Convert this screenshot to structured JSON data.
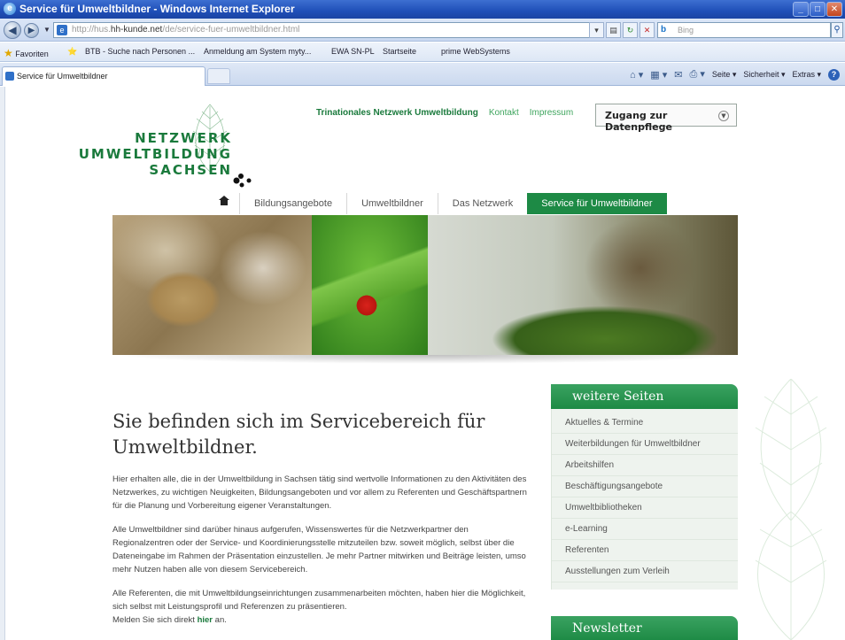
{
  "browser": {
    "window_title": "Service für Umweltbildner - Windows Internet Explorer",
    "url_prefix": "http://hus.",
    "url_domain": "hh-kunde.net",
    "url_path": "/de/service-fuer-umweltbildner.html",
    "search_placeholder": "Bing",
    "favorites": {
      "label": "Favoriten",
      "items": [
        "BTB - Suche nach Personen ...",
        "Anmeldung am System myty...",
        "EWA SN-PL",
        "Startseite",
        "prime WebSystems"
      ]
    },
    "tab_label": "Service für Umweltbildner",
    "commands": [
      "Seite ▾",
      "Sicherheit ▾",
      "Extras ▾"
    ]
  },
  "header": {
    "logo_lines": [
      "NETZWERK",
      "UMWELTBILDUNG",
      "SACHSEN"
    ],
    "top_links": {
      "main": "Trinationales Netzwerk Umweltbildung",
      "kontakt": "Kontakt",
      "impressum": "Impressum"
    },
    "datenpflege_label": "Zugang zur Datenpflege"
  },
  "nav": {
    "items": [
      "Bildungsangebote",
      "Umweltbildner",
      "Das Netzwerk",
      "Service für Umweltbildner"
    ],
    "active_index": 3
  },
  "main": {
    "heading": "Sie befinden sich im Servicebereich für Umweltbildner.",
    "paragraphs": [
      "Hier erhalten alle, die in der Umweltbildung in Sachsen tätig sind wertvolle Informationen zu den Aktivitäten des Netzwerkes, zu wichtigen Neuigkeiten, Bildungsangeboten und vor allem zu Referenten und Geschäftspartnern für die Planung und Vorbereitung eigener Veranstaltungen.",
      "Alle Umweltbildner sind darüber hinaus aufgerufen, Wissenswertes für die Netzwerkpartner den Regionalzentren oder der Service- und Koordinierungsstelle mitzuteilen bzw. soweit möglich, selbst über die Dateneingabe im Rahmen der Präsentation einzustellen. Je mehr Partner mitwirken und Beiträge leisten, umso mehr Nutzen haben alle von diesem Servicebereich.",
      "Alle Referenten, die mit Umweltbildungseinrichtungen zusammenarbeiten möchten, haben hier die Möglichkeit, sich selbst mit Leistungsprofil und Referenzen zu präsentieren."
    ],
    "last_line_prefix": "Melden Sie sich direkt ",
    "last_line_link": "hier",
    "last_line_suffix": " an."
  },
  "sidebar": {
    "title": "weitere Seiten",
    "items": [
      "Aktuelles & Termine",
      "Weiterbildungen für Umweltbildner",
      "Arbeitshilfen",
      "Beschäftigungsangebote",
      "Umweltbibliotheken",
      "e-Learning",
      "Referenten",
      "Ausstellungen zum Verleih"
    ],
    "newsletter_title": "Newsletter"
  },
  "colors": {
    "brand_green": "#1d8a45",
    "ie_titlebar": "#1f4fb8"
  },
  "icons": [
    "ie-icon",
    "back-arrow-icon",
    "forward-arrow-icon",
    "page-icon",
    "refresh-icon",
    "stop-icon",
    "bing-icon",
    "search-icon",
    "star-icon",
    "home-icon",
    "chevron-down-icon",
    "help-icon"
  ]
}
